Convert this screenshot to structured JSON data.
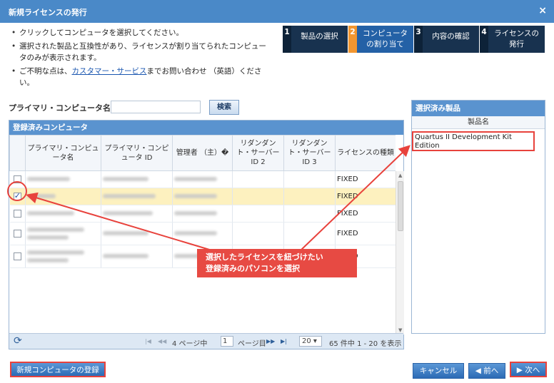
{
  "dialog": {
    "title": "新規ライセンスの発行",
    "close_icon": "×"
  },
  "instructions": [
    {
      "text": "クリックしてコンピュータを選択してください。"
    },
    {
      "text": "選択された製品と互換性があり、ライセンスが割り当てられたコンピュータのみが表示されます。"
    },
    {
      "text_before": "ご不明な点は、",
      "link": "カスタマー・サービス",
      "text_after": "までお問い合わせ （英語）ください。"
    }
  ],
  "steps": [
    {
      "num": "1",
      "label": "製品の選択",
      "active": false
    },
    {
      "num": "2",
      "label": "コンピュータの割り当て",
      "active": true
    },
    {
      "num": "3",
      "label": "内容の確認",
      "active": false
    },
    {
      "num": "4",
      "label": "ライセンスの発行",
      "active": false
    }
  ],
  "search": {
    "label": "プライマリ・コンピュータ名",
    "value": "",
    "button": "検索"
  },
  "registered": {
    "header": "登録済みコンピュータ",
    "columns": [
      "",
      "プライマリ・コンピュータ名",
      "プライマリ・コンピュータ ID",
      "管理者 （主）�",
      "リダンダント・サーバー ID 2",
      "リダンダント・サーバー ID 3",
      "ライセンスの種類"
    ],
    "rows": [
      {
        "checked": false,
        "license": "FIXED",
        "tall": false
      },
      {
        "checked": true,
        "license": "FIXED",
        "tall": false
      },
      {
        "checked": false,
        "license": "FIXED",
        "tall": false
      },
      {
        "checked": false,
        "license": "FIXED",
        "tall": true
      },
      {
        "checked": false,
        "license": "FIXED",
        "tall": true
      }
    ],
    "pager": {
      "refresh_icon": "⟳",
      "first_icon": "|◀",
      "prev_icon": "◀◀",
      "page_prefix": "4 ページ中",
      "page_value": "1",
      "page_suffix": "ページ目",
      "next_icon": "▶▶",
      "last_icon": "▶|",
      "page_size": "20",
      "summary": "65 件中 1 - 20 を表示"
    }
  },
  "selected_products": {
    "header": "選択済み製品",
    "column": "製品名",
    "items": [
      "Quartus II Development Kit Edition"
    ]
  },
  "buttons": {
    "new_computer": "新規コンピュータの登録",
    "cancel": "キャンセル",
    "prev": "◀ 前へ",
    "next": "▶ 次へ"
  },
  "callout": {
    "line1": "選択したライセンスを紐づけたい",
    "line2": "登録済みのパソコンを選択"
  },
  "colors": {
    "accent": "#4a89c8",
    "step_active_num": "#f29630",
    "highlight": "#e8423c",
    "selected_row": "#fdf1bf"
  }
}
